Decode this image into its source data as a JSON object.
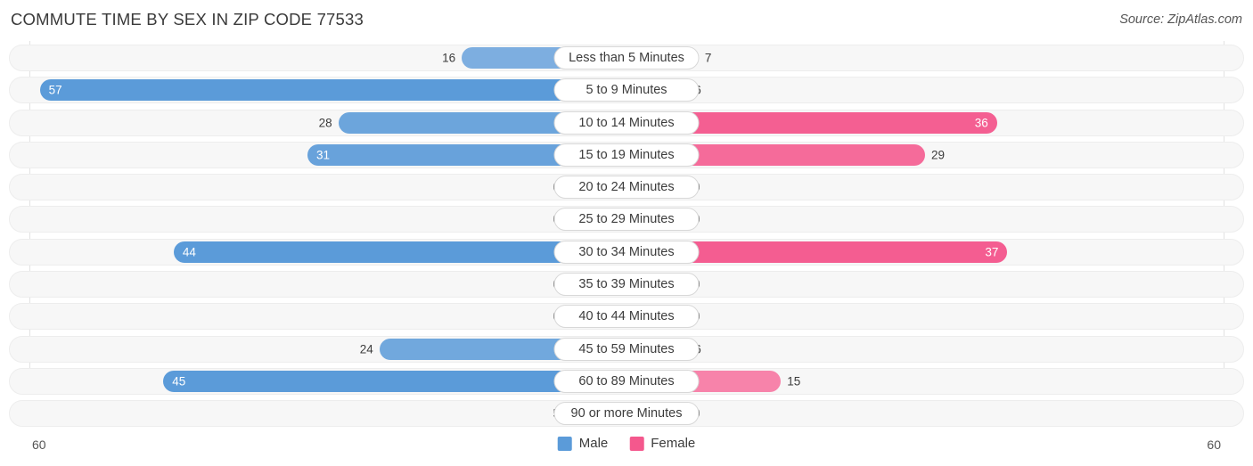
{
  "header": {
    "title": "COMMUTE TIME BY SEX IN ZIP CODE 77533",
    "source": "Source: ZipAtlas.com"
  },
  "axis": {
    "left_label": "60",
    "right_label": "60"
  },
  "legend": {
    "male_label": "Male",
    "female_label": "Female",
    "male_color": "#5b9bd9",
    "female_color": "#f4588d"
  },
  "colors": {
    "male_light": "#93bbe4",
    "male_strong": "#5b9bd9",
    "female_light": "#f89dbc",
    "female_strong": "#f4588d",
    "track": "#f7f7f7",
    "track_border": "#ededed",
    "gridline": "#e2e2e2"
  },
  "chart_data": {
    "type": "bar",
    "subtype": "diverging-horizontal-bar",
    "title": "COMMUTE TIME BY SEX IN ZIP CODE 77533",
    "xlabel": "",
    "ylabel": "",
    "axis_max": 60,
    "xlim": [
      60,
      60
    ],
    "grid": true,
    "legend_position": "bottom-center",
    "categories": [
      "Less than 5 Minutes",
      "5 to 9 Minutes",
      "10 to 14 Minutes",
      "15 to 19 Minutes",
      "20 to 24 Minutes",
      "25 to 29 Minutes",
      "30 to 34 Minutes",
      "35 to 39 Minutes",
      "40 to 44 Minutes",
      "45 to 59 Minutes",
      "60 to 89 Minutes",
      "90 or more Minutes"
    ],
    "series": [
      {
        "name": "Male",
        "values": [
          16,
          57,
          28,
          31,
          0,
          0,
          44,
          0,
          0,
          24,
          45,
          5
        ]
      },
      {
        "name": "Female",
        "values": [
          7,
          6,
          36,
          29,
          0,
          0,
          37,
          0,
          0,
          6,
          15,
          0
        ]
      }
    ]
  }
}
